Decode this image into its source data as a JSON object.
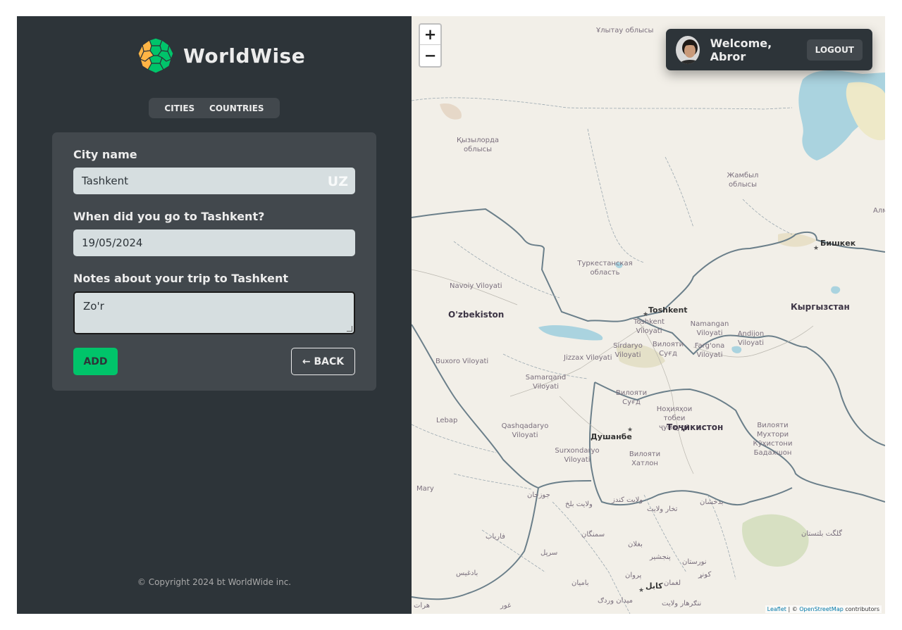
{
  "app": {
    "name": "WorldWise"
  },
  "nav": {
    "items": [
      "Cities",
      "Countries"
    ]
  },
  "form": {
    "city_label": "City name",
    "city_value": "Tashkent",
    "country_code": "UZ",
    "date_label": "When did you go to Tashkent?",
    "date_value": "19/05/2024",
    "notes_label": "Notes about your trip to Tashkent",
    "notes_value": "Zo'r",
    "add_label": "ADD",
    "back_label": "← BACK"
  },
  "footer": {
    "copyright": "© Copyright 2024 bt WorldWide inc."
  },
  "user": {
    "welcome": "Welcome, Abror",
    "logout_label": "LOGOUT"
  },
  "map": {
    "zoom_in": "+",
    "zoom_out": "−",
    "attribution_leaflet": "Leaflet",
    "attribution_sep": " | © ",
    "attribution_osm": "OpenStreetMap",
    "attribution_suffix": " contributors",
    "labels": [
      "Ұлытау облысы",
      "Қызылорда облысы",
      "Жамбыл облысы",
      "Алм",
      "Бишкек",
      "Туркестанская область",
      "Navoiy Viloyati",
      "O'zbekiston",
      "Toshkent",
      "Toshkent Viloyati",
      "Кыргызстан",
      "Namangan Viloyati",
      "Andijon Viloyati",
      "Sirdaryo Viloyati",
      "Вилояти Суғд",
      "Farg'ona Viloyati",
      "Buxoro Viloyati",
      "Jizzax Viloyati",
      "Samarqand Viloyati",
      "Вилояти Суғд",
      "Ноҳияҳои тобеи ҷумҳурӣ",
      "Lebap",
      "Qashqadaryo Viloyati",
      "Душанбе",
      "Тоҷикистон",
      "Вилояти Мухтори Кӯҳистони Бадахшон",
      "Surxondaryo Viloyati",
      "Вилояти Хатлон",
      "Mary",
      "جوزجان",
      "ولایت بلخ",
      "ولایت کندز",
      "تخار ولایت",
      "بدخشان",
      "گلگت بلتستان",
      "سمنگان",
      "فاریاب",
      "بغلان",
      "سرپل",
      "پنجشیر",
      "نورستان",
      "بادغیس",
      "بامیان",
      "پروان",
      "لغمان",
      "کونړ",
      "کابل",
      "میدان وردګ",
      "ننګرهار ولایت",
      "غور",
      "هرات"
    ]
  },
  "colors": {
    "sidebar": "#2d3439",
    "panel": "#42484d",
    "accent": "#00c46a",
    "text": "#ececec",
    "field": "#d6dee0",
    "water": "#8ed0d6",
    "border": "#6b7f8a"
  }
}
